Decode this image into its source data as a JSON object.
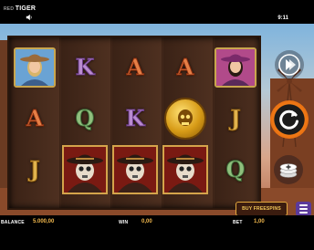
{
  "status": {
    "brand_small": "RED",
    "brand_main": "TIGER",
    "clock": "9:11"
  },
  "reels": [
    [
      {
        "type": "portrait",
        "name": "cowboy-woman-portrait"
      },
      {
        "type": "letter",
        "v": "A",
        "c": "A"
      },
      {
        "type": "letter",
        "v": "J",
        "c": "J"
      }
    ],
    [
      {
        "type": "letter",
        "v": "K",
        "c": "K"
      },
      {
        "type": "letter",
        "v": "Q",
        "c": "Q"
      },
      {
        "type": "bandit",
        "name": "skull-bandit-symbol"
      }
    ],
    [
      {
        "type": "letter",
        "v": "A",
        "c": "A"
      },
      {
        "type": "letter",
        "v": "K",
        "c": "K"
      },
      {
        "type": "bandit",
        "name": "skull-bandit-symbol"
      }
    ],
    [
      {
        "type": "letter",
        "v": "A",
        "c": "A"
      },
      {
        "type": "coin",
        "name": "gold-skull-coin-symbol"
      },
      {
        "type": "bandit",
        "name": "skull-bandit-symbol"
      }
    ],
    [
      {
        "type": "portrait2",
        "name": "outlaw-woman-portrait"
      },
      {
        "type": "letter",
        "v": "J",
        "c": "J"
      },
      {
        "type": "letter",
        "v": "Q",
        "c": "Q"
      }
    ]
  ],
  "buttons": {
    "buy_freespins": "BUY FREESPINS"
  },
  "footer": {
    "balance_label": "BALANCE",
    "balance_value": "5.000,00",
    "win_label": "WIN",
    "win_value": "0,00",
    "bet_label": "BET",
    "bet_value": "1,00"
  },
  "colors": {
    "accent": "#f2b84c",
    "spin": "#f07a16",
    "menu": "#5b3a9b"
  },
  "icons": [
    "sound-icon",
    "autoplay-arrows-icon",
    "spin-icon",
    "bet-chips-icon",
    "menu-icon"
  ]
}
